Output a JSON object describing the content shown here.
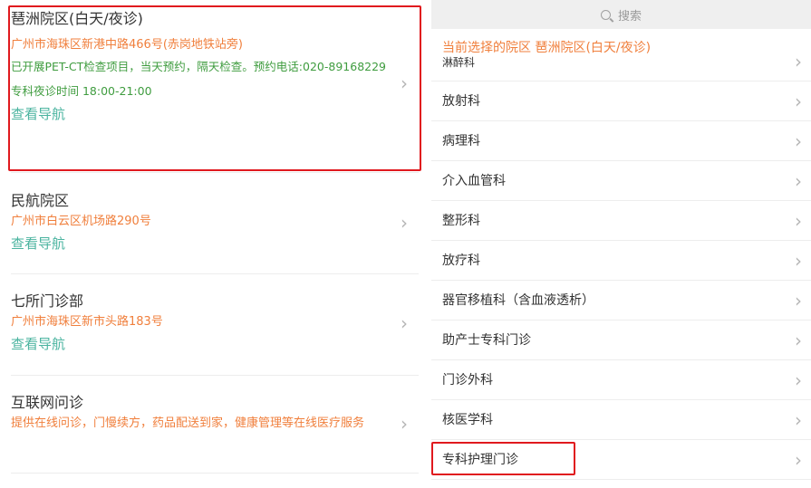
{
  "campuses": [
    {
      "name": "琶洲院区(白天/夜诊)",
      "address": "广州市海珠区新港中路466号(赤岗地铁站旁)",
      "note": "已开展PET-CT检查项目，当天预约，隔天检查。预约电话:020-89168229",
      "hours": "专科夜诊时间 18:00-21:00",
      "nav": "查看导航"
    },
    {
      "name": "民航院区",
      "address": "广州市白云区机场路290号",
      "nav": "查看导航"
    },
    {
      "name": "七所门诊部",
      "address": "广州市海珠区新市头路183号",
      "nav": "查看导航"
    },
    {
      "name": "互联网问诊",
      "desc": "提供在线问诊，门慢续方，药品配送到家，健康管理等在线医疗服务"
    }
  ],
  "search": {
    "placeholder": "搜索"
  },
  "current": "当前选择的院区 琶洲院区(白天/夜诊)",
  "departments": [
    "淋醉科",
    "放射科",
    "病理科",
    "介入血管科",
    "整形科",
    "放疗科",
    "器官移植科（含血液透析）",
    "助产士专科门诊",
    "门诊外科",
    "核医学科",
    "专科护理门诊"
  ],
  "colors": {
    "orange": "#f07f3c",
    "green": "#3f9c3f",
    "teal": "#4bb4a0",
    "highlight": "#e0191e"
  },
  "chevron": "›"
}
